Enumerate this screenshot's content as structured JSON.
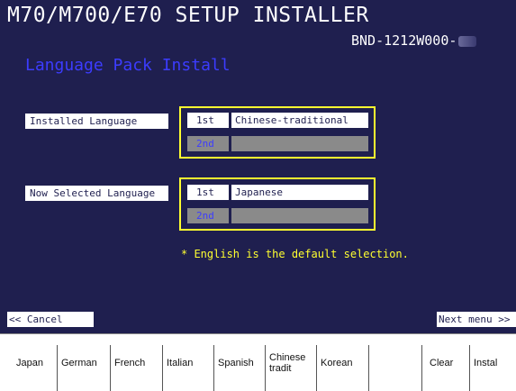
{
  "header": {
    "title": "M70/M700/E70 SETUP INSTALLER",
    "version": "BND-1212W000-"
  },
  "section_title": "Language Pack Install",
  "installed": {
    "label": "Installed Language",
    "first_ord": "1st",
    "first_value": "Chinese-traditional",
    "second_ord": "2nd",
    "second_value": ""
  },
  "selected": {
    "label": "Now Selected Language",
    "first_ord": "1st",
    "first_value": "Japanese",
    "second_ord": "2nd",
    "second_value": ""
  },
  "note": "* English is the default selection.",
  "nav": {
    "cancel": "<< Cancel",
    "next": "Next menu >>"
  },
  "function_keys": {
    "japan": "Japan",
    "german": "German",
    "french": "French",
    "italian": "Italian",
    "spanish": "Spanish",
    "chinese": "Chinese tradit",
    "korean": "Korean",
    "blank": "",
    "clear": "Clear",
    "install": "Instal"
  },
  "colors": {
    "background": "#1f1f4f",
    "accent_blue": "#3c3cff",
    "highlight_yellow": "#ffff30",
    "disabled_gray": "#8a8a8a"
  }
}
